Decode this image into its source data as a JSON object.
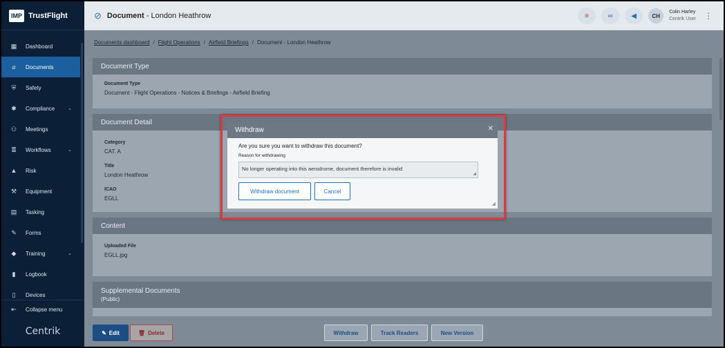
{
  "app": {
    "logo_text": "IMP",
    "name": "TrustFlight"
  },
  "sidebar": {
    "items": [
      {
        "label": "Dashboard",
        "icon": "dashboard-icon",
        "glyph": "▦"
      },
      {
        "label": "Documents",
        "icon": "paperclip-icon",
        "glyph": "⌀",
        "active": true
      },
      {
        "label": "Safety",
        "icon": "shield-icon",
        "glyph": "⛨"
      },
      {
        "label": "Compliance",
        "icon": "compliance-icon",
        "glyph": "✱",
        "chevron": "⌄"
      },
      {
        "label": "Meetings",
        "icon": "meetings-icon",
        "glyph": "⚇"
      },
      {
        "label": "Workflows",
        "icon": "workflows-icon",
        "glyph": "≣",
        "chevron": "⌄"
      },
      {
        "label": "Risk",
        "icon": "warning-icon",
        "glyph": "▲"
      },
      {
        "label": "Equipment",
        "icon": "wrench-icon",
        "glyph": "⚒"
      },
      {
        "label": "Tasking",
        "icon": "tasking-icon",
        "glyph": "▤"
      },
      {
        "label": "Forms",
        "icon": "forms-icon",
        "glyph": "✎"
      },
      {
        "label": "Training",
        "icon": "graduation-cap-icon",
        "glyph": "◆",
        "chevron": "⌄"
      },
      {
        "label": "Logbook",
        "icon": "book-icon",
        "glyph": "▮"
      },
      {
        "label": "Devices",
        "icon": "devices-icon",
        "glyph": "▯"
      }
    ],
    "collapse_label": "Collapse menu",
    "footer_brand": "Centrik"
  },
  "header": {
    "title_prefix": "Document",
    "title_suffix": " - London Heathrow",
    "user_initials": "CH",
    "user_name": "Colin Harley",
    "user_role": "Centrik User"
  },
  "breadcrumb": {
    "items": [
      "Documents dashboard",
      "Flight Operations",
      "Airfield Briefings"
    ],
    "current": "Document - London Heathrow"
  },
  "sections": {
    "doc_type": {
      "title": "Document Type",
      "label": "Document Type",
      "value": "Document - Flight Operations - Notices & Briefings - Airfield Briefing"
    },
    "doc_detail": {
      "title": "Document Detail",
      "category_label": "Category",
      "category_value": "CAT. A",
      "title_label": "Title",
      "title_value": "London Heathrow",
      "icao_label": "ICAO",
      "icao_value": "EGLL"
    },
    "content": {
      "title": "Content",
      "file_label": "Uploaded File",
      "file_value": "EGLL.jpg"
    },
    "supplemental": {
      "title": "Supplemental Documents",
      "subtitle": "(Public)"
    }
  },
  "actions": {
    "edit": "Edit",
    "delete": "Delete",
    "withdraw": "Withdraw",
    "track_readers": "Track Readers",
    "new_version": "New Version"
  },
  "modal": {
    "title": "Withdraw",
    "question": "Are you sure you want to withdraw this document?",
    "reason_label": "Reason for withdrawing",
    "reason_value": "No longer operating into this aerodrome, document therefore is invalid",
    "confirm_label": "Withdraw document",
    "cancel_label": "Cancel"
  },
  "colors": {
    "sidebar_bg": "#0b2037",
    "active_nav": "#1b5f9e",
    "highlight_border": "#e0393b",
    "primary": "#1d4e83"
  }
}
